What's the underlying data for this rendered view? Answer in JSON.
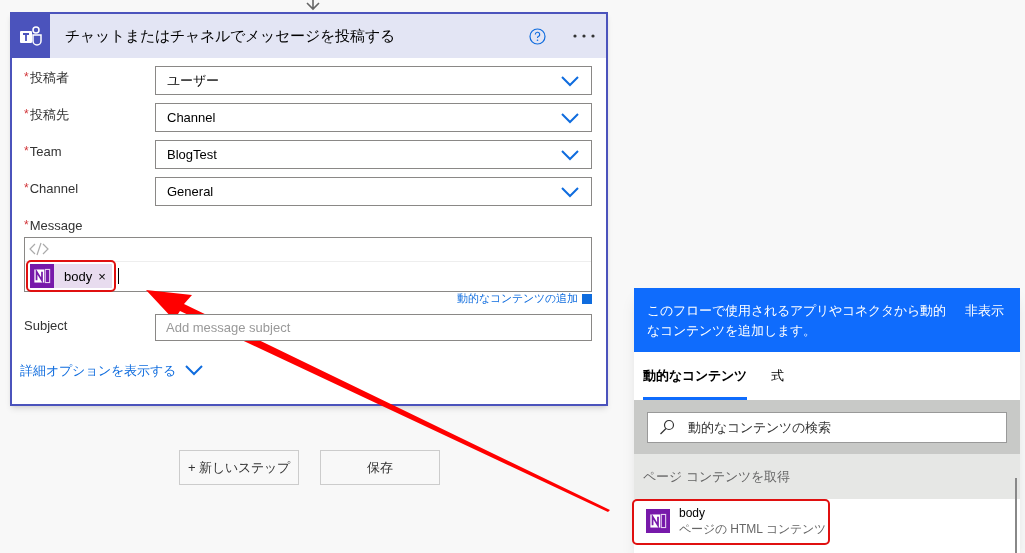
{
  "card": {
    "title": "チャットまたはチャネルでメッセージを投稿する",
    "fields": [
      {
        "kind": "dropdown",
        "mark": "*",
        "label": "投稿者",
        "value": "ユーザー"
      },
      {
        "kind": "dropdown",
        "mark": "*",
        "label": "投稿先",
        "value": "Channel"
      },
      {
        "kind": "dropdown",
        "mark": "*",
        "label": "Team",
        "value": "BlogTest"
      },
      {
        "kind": "dropdown",
        "mark": "*",
        "label": "Channel",
        "value": "General"
      },
      {
        "kind": "editor",
        "mark": "*",
        "label": "Message",
        "token": "body",
        "remove": "×",
        "link": "動的なコンテンツの追加"
      },
      {
        "kind": "text",
        "label": "Subject",
        "placeholder": "Add message subject"
      }
    ],
    "advanced_link": "詳細オプションを表示する"
  },
  "buttons": [
    "+ 新しいステップ",
    "保存"
  ],
  "panel": {
    "info": "このフローで使用されるアプリやコネクタから動的なコンテンツを追加します。",
    "hide": "非表示",
    "tabs": [
      {
        "label": "動的なコンテンツ",
        "selected": true
      },
      {
        "label": "式",
        "selected": false
      }
    ],
    "search": {
      "placeholder": "動的なコンテンツの検索"
    },
    "groups": [
      {
        "title": "ページ コンテンツを取得",
        "items": [
          {
            "name": "body",
            "description": "ページの HTML コンテンツ"
          }
        ]
      }
    ]
  }
}
